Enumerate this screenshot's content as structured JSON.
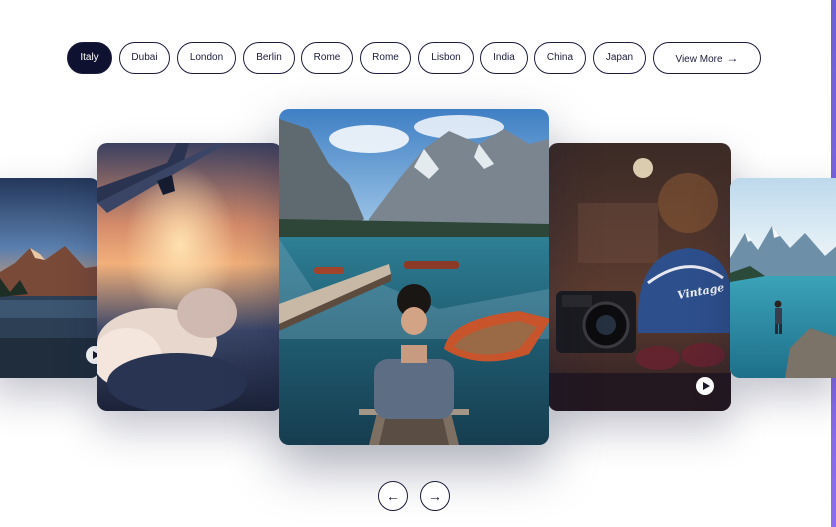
{
  "filters": [
    {
      "label": "Italy",
      "active": true
    },
    {
      "label": "Dubai"
    },
    {
      "label": "London"
    },
    {
      "label": "Berlin"
    },
    {
      "label": "Rome"
    },
    {
      "label": "Rome"
    },
    {
      "label": "Lisbon"
    },
    {
      "label": "India"
    },
    {
      "label": "China"
    },
    {
      "label": "Japan"
    }
  ],
  "view_more": {
    "label": "View More",
    "icon": "arrow-right-icon"
  },
  "cards": [
    {
      "scene": "mountain lake at sunset",
      "has_play": true
    },
    {
      "scene": "airplane wing above clouds"
    },
    {
      "scene": "man on dock at alpine lake"
    },
    {
      "scene": "camera, sunglasses and Vintage cap",
      "cap_text": "Vintage",
      "has_play": true
    },
    {
      "scene": "hiker at turquoise mountain lake"
    }
  ],
  "nav": {
    "prev_icon": "arrow-left-icon",
    "next_icon": "arrow-right-icon"
  },
  "colors": {
    "accent": "#0f1130",
    "edge": "#7a66e8"
  }
}
